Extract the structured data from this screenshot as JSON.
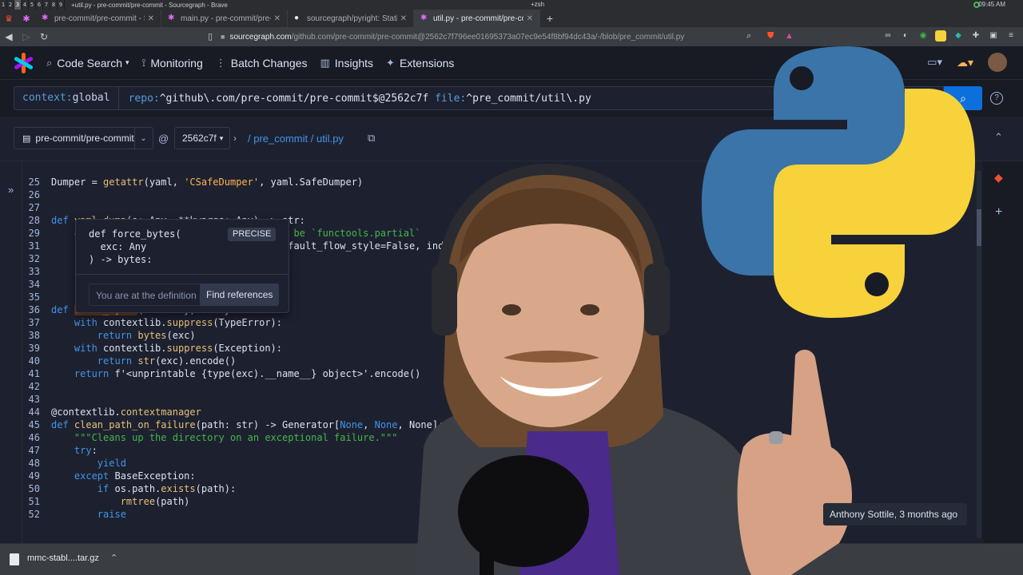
{
  "system": {
    "workspaces": [
      "1",
      "2",
      "3",
      "4",
      "5",
      "6",
      "7",
      "8",
      "9"
    ],
    "active_workspace": "3",
    "window_title": "+util.py - pre-commit/pre-commit - Sourcegraph - Brave",
    "terminal_title": "+zsh",
    "clock": "09:45 AM"
  },
  "tabs": [
    {
      "label": "pre-commit/pre-commit - Sour"
    },
    {
      "label": "main.py - pre-commit/pre-com"
    },
    {
      "label": "sourcegraph/pyright: Static ty"
    },
    {
      "label": "util.py - pre-commit/pre-com",
      "active": true
    }
  ],
  "address": {
    "host": "sourcegraph.com",
    "path": "/github.com/pre-commit/pre-commit@2562c7f796ee01695373a07ec9e54f8bf94dc43a/-/blob/pre_commit/util.py"
  },
  "nav": {
    "code_search": "Code Search",
    "monitoring": "Monitoring",
    "batch_changes": "Batch Changes",
    "insights": "Insights",
    "extensions": "Extensions"
  },
  "search": {
    "context_key": "context:",
    "context_value": "global",
    "repo_key": "repo:",
    "repo_value": "^github\\.com/pre-commit/pre-commit$@2562c7f",
    "file_key": "file:",
    "file_value": "^pre_commit/util\\.py"
  },
  "crumbs": {
    "repo": "pre-commit/pre-commit",
    "at": "@",
    "rev": "2562c7f",
    "path": "/  pre_commit / util.py"
  },
  "code": [
    {
      "n": "25",
      "parts": [
        [
          "src",
          "Dumper = "
        ],
        [
          "tk-fn",
          "getattr"
        ],
        [
          "src",
          "(yaml, "
        ],
        [
          "tk-str",
          "'CSafeDumper'"
        ],
        [
          "src",
          ", yaml.SafeDumper)"
        ]
      ]
    },
    {
      "n": "26",
      "parts": []
    },
    {
      "n": "27",
      "parts": []
    },
    {
      "n": "28",
      "parts": [
        [
          "tk-kw",
          "def "
        ],
        [
          "tk-fn",
          "yaml_dump"
        ],
        [
          "src",
          "(o: Any, **kwargs: Any) -> str:"
        ]
      ]
    },
    {
      "n": "29",
      "parts": [
        [
          "src",
          "    "
        ],
        [
          "tk-cm",
          "# when kwargs are passed in, this can be `functools.partial`"
        ]
      ]
    },
    {
      "n": "31",
      "parts": [
        [
          "src",
          "    "
        ],
        [
          "tk-kw",
          "return "
        ],
        [
          "src",
          "yaml.dump(o, Dumper=Dumper, default_flow_style=False, indent=4, sort_keys=False)"
        ]
      ]
    },
    {
      "n": "32",
      "parts": []
    },
    {
      "n": "33",
      "parts": []
    },
    {
      "n": "34",
      "parts": []
    },
    {
      "n": "35",
      "parts": []
    },
    {
      "n": "36",
      "parts": [
        [
          "tk-kw",
          "def "
        ],
        [
          "hl tk-fn",
          "force_bytes"
        ],
        [
          "src",
          "(exc: Any) -> bytes:"
        ]
      ]
    },
    {
      "n": "37",
      "parts": [
        [
          "src",
          "    "
        ],
        [
          "tk-kw",
          "with "
        ],
        [
          "src",
          "contextlib."
        ],
        [
          "tk-fn",
          "suppress"
        ],
        [
          "src",
          "(TypeError):"
        ]
      ]
    },
    {
      "n": "38",
      "parts": [
        [
          "src",
          "        "
        ],
        [
          "tk-kw",
          "return "
        ],
        [
          "tk-fn",
          "bytes"
        ],
        [
          "src",
          "(exc)"
        ]
      ]
    },
    {
      "n": "39",
      "parts": [
        [
          "src",
          "    "
        ],
        [
          "tk-kw",
          "with "
        ],
        [
          "src",
          "contextlib."
        ],
        [
          "tk-fn",
          "suppress"
        ],
        [
          "src",
          "(Exception):"
        ]
      ]
    },
    {
      "n": "40",
      "parts": [
        [
          "src",
          "        "
        ],
        [
          "tk-kw",
          "return "
        ],
        [
          "tk-fn",
          "str"
        ],
        [
          "src",
          "(exc).encode()"
        ]
      ]
    },
    {
      "n": "41",
      "parts": [
        [
          "src",
          "    "
        ],
        [
          "tk-kw",
          "return "
        ],
        [
          "src",
          "f'<unprintable {type(exc).__name__} object>'.encode()"
        ]
      ]
    },
    {
      "n": "42",
      "parts": []
    },
    {
      "n": "43",
      "parts": []
    },
    {
      "n": "44",
      "parts": [
        [
          "src",
          "@contextlib."
        ],
        [
          "tk-fn",
          "contextmanager"
        ]
      ]
    },
    {
      "n": "45",
      "parts": [
        [
          "tk-kw",
          "def "
        ],
        [
          "tk-fn",
          "clean_path_on_failure"
        ],
        [
          "src",
          "(path: str) -> Generator["
        ],
        [
          "tk-kw",
          "None"
        ],
        [
          "src",
          ", "
        ],
        [
          "tk-kw",
          "None"
        ],
        [
          "src",
          ", None]:"
        ]
      ]
    },
    {
      "n": "46",
      "parts": [
        [
          "src",
          "    "
        ],
        [
          "tk-cm",
          "\"\"\"Cleans up the directory on an exceptional failure.\"\"\""
        ]
      ]
    },
    {
      "n": "47",
      "parts": [
        [
          "src",
          "    "
        ],
        [
          "tk-kw",
          "try"
        ],
        [
          "src",
          ":"
        ]
      ]
    },
    {
      "n": "48",
      "parts": [
        [
          "src",
          "        "
        ],
        [
          "tk-kw",
          "yield"
        ]
      ]
    },
    {
      "n": "49",
      "parts": [
        [
          "src",
          "    "
        ],
        [
          "tk-kw",
          "except "
        ],
        [
          "src",
          "BaseException:"
        ]
      ]
    },
    {
      "n": "50",
      "parts": [
        [
          "src",
          "        "
        ],
        [
          "tk-kw",
          "if "
        ],
        [
          "src",
          "os.path."
        ],
        [
          "tk-fn",
          "exists"
        ],
        [
          "src",
          "(path):"
        ]
      ]
    },
    {
      "n": "51",
      "parts": [
        [
          "src",
          "            "
        ],
        [
          "tk-fn",
          "rmtree"
        ],
        [
          "src",
          "(path)"
        ]
      ]
    },
    {
      "n": "52",
      "parts": [
        [
          "src",
          "        "
        ],
        [
          "tk-kw",
          "raise"
        ]
      ]
    }
  ],
  "hover": {
    "signature": "def force_bytes(\n  exc: Any\n) -> bytes:",
    "badge": "PRECISE",
    "at_definition": "You are at the definition",
    "find_references": "Find references"
  },
  "blame": "Anthony Sottile, 3 months ago",
  "download": {
    "filename": "mmc-stabl....tar.gz"
  },
  "colors": {
    "python_blue": "#3b74a8",
    "python_yellow": "#f7d23a",
    "accent": "#0b70db"
  }
}
